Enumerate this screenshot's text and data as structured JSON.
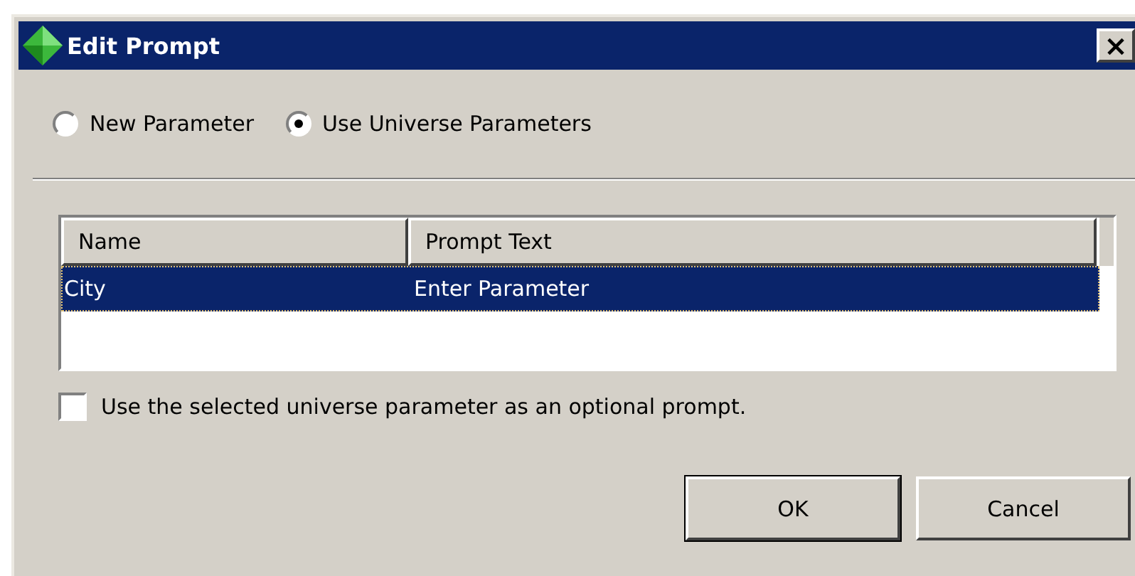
{
  "window": {
    "title": "Edit Prompt",
    "close": "×"
  },
  "modes": [
    {
      "label": "New Parameter",
      "selected": false
    },
    {
      "label": "Use Universe Parameters",
      "selected": true
    }
  ],
  "table": {
    "columns": [
      "Name",
      "Prompt Text"
    ],
    "rows": [
      {
        "cells": [
          "City",
          "Enter Parameter"
        ],
        "selected": true
      }
    ]
  },
  "optional": {
    "label": "Use the selected universe parameter as an optional prompt.",
    "checked": false
  },
  "buttons": [
    {
      "label": "OK",
      "kind": "default"
    },
    {
      "label": "Cancel",
      "kind": "normal"
    }
  ]
}
